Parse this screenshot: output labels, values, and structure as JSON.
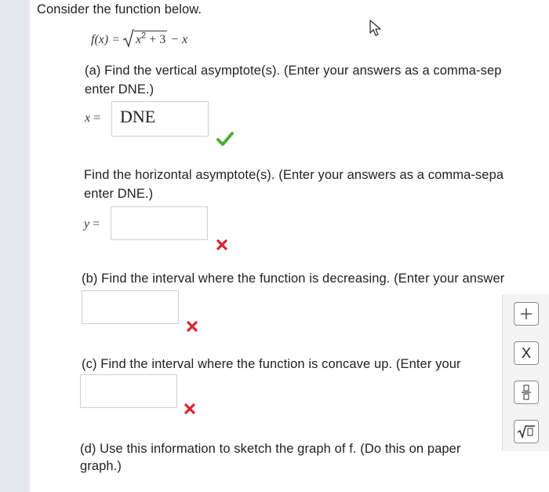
{
  "intro": "Consider the function below.",
  "function": {
    "lhs": "f(x) = ",
    "radicand_base": "x",
    "radicand_exp": "2",
    "radicand_rest": " + 3",
    "rest": " − x"
  },
  "part_a": {
    "line1": "(a) Find the vertical asymptote(s). (Enter your answers as a comma-sep",
    "line2": "enter DNE.)",
    "v_label": "x =",
    "v_value": "DNE",
    "h_line1": "Find the horizontal asymptote(s). (Enter your answers as a comma-sepa",
    "h_line2": "enter DNE.)",
    "h_label": "y ="
  },
  "part_b": {
    "text": "(b) Find the interval where the function is decreasing. (Enter your answer"
  },
  "part_c": {
    "text": "(c) Find the interval where the function is concave up. (Enter your"
  },
  "part_d": {
    "line1": "(d) Use this information to sketch the graph of f. (Do this on paper",
    "line2": "graph.)"
  },
  "palette": {
    "plus": "+",
    "times": "X",
    "fraction": "□/□",
    "sqrt": "√□"
  },
  "colors": {
    "correct": "#4caf32",
    "incorrect": "#d9232e"
  }
}
